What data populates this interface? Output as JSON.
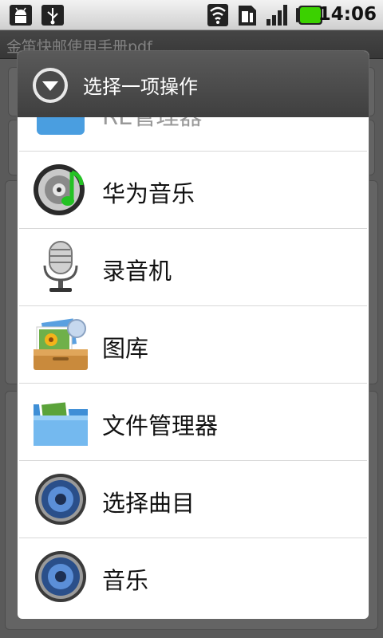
{
  "status_bar": {
    "time": "14:06",
    "icons": [
      "android-debug-icon",
      "usb-icon",
      "wifi-icon",
      "sim-card-icon",
      "signal-icon",
      "battery-icon"
    ],
    "battery_color": "#3bd100"
  },
  "background_app": {
    "title": "金笛快邮使用手册pdf"
  },
  "dialog": {
    "title": "选择一项操作",
    "items": [
      {
        "label": "RE管理器",
        "icon": "file-manager-blue-icon"
      },
      {
        "label": "华为音乐",
        "icon": "music-disc-icon"
      },
      {
        "label": "录音机",
        "icon": "microphone-icon"
      },
      {
        "label": "图库",
        "icon": "gallery-icon"
      },
      {
        "label": "文件管理器",
        "icon": "folder-icon"
      },
      {
        "label": "选择曲目",
        "icon": "speaker-icon"
      },
      {
        "label": "音乐",
        "icon": "speaker-icon"
      }
    ]
  }
}
